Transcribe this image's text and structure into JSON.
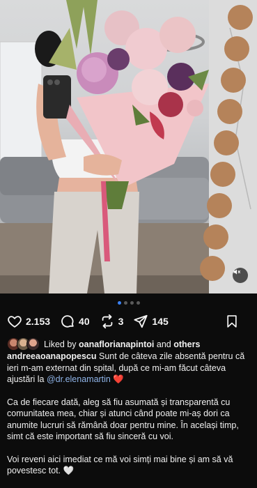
{
  "post": {
    "media_alt": "Woman holding pink bouquet of flowers taking mirror selfie",
    "carousel": {
      "count": 4,
      "active_index": 0
    }
  },
  "actions": {
    "likes_count": "2.153",
    "comments_count": "40",
    "reposts_count": "3",
    "shares_count": "145"
  },
  "liked_by": {
    "prefix": "Liked by",
    "user": "oanaflorianapintoi",
    "and": "and",
    "others": "others"
  },
  "caption": {
    "username": "andreeaoanapopescu",
    "p1_text": "Sunt de câteva zile absentă pentru că ieri m-am externat din spital, după ce mi-am făcut câteva ajustări la",
    "p1_mention": "@dr.elenamartin",
    "p1_emoji": "❤️",
    "p2": "Ca de fiecare dată, aleg să fiu asumată și transparentă cu comunitatea mea, chiar și atunci când poate mi-aș dori ca anumite lucruri să rămână doar pentru mine. În același timp, simt că este important să fiu sinceră cu voi.",
    "p3_text": "Voi reveni aici imediat ce mă voi simți mai bine și am să vă povestesc tot.",
    "p3_emoji": "🤍"
  },
  "icons": {
    "like": "heart-icon",
    "comment": "comment-icon",
    "repost": "repost-icon",
    "share": "send-icon",
    "save": "bookmark-icon",
    "mute": "speaker-muted-icon"
  },
  "colors": {
    "background": "#0c0c0c",
    "text": "#f2f2f2",
    "mention": "#8fb4e8",
    "carousel_active": "#3b82f6",
    "carousel_inactive": "#5a5a5a"
  }
}
